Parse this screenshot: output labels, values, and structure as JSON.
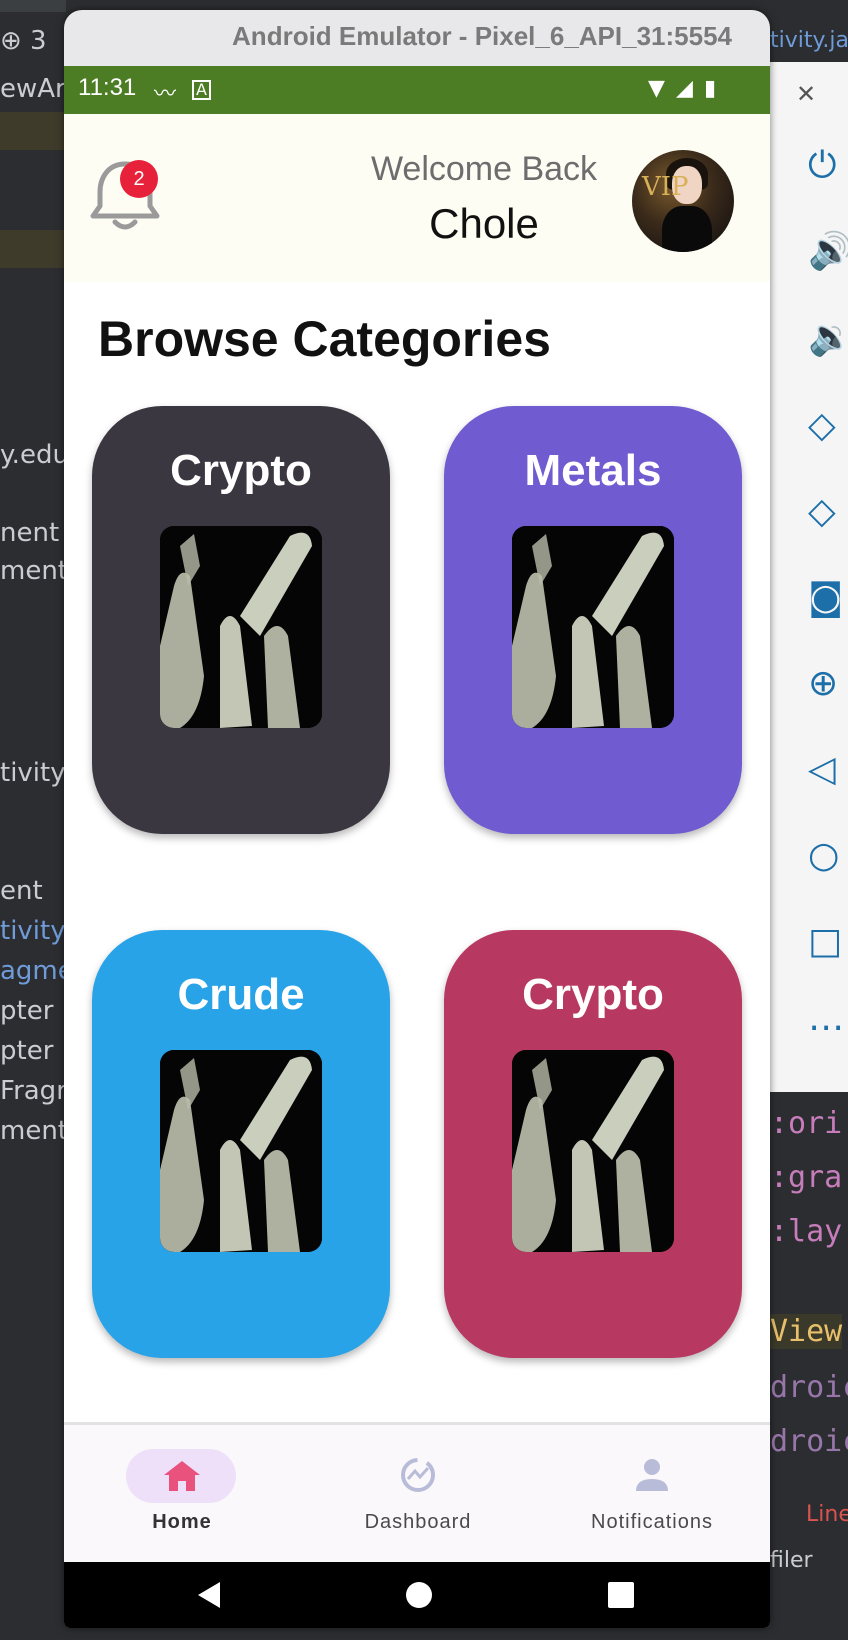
{
  "window": {
    "title": "Android Emulator - Pixel_6_API_31:5554"
  },
  "status_bar": {
    "time": "11:31"
  },
  "header": {
    "notification_count": "2",
    "welcome": "Welcome Back",
    "username": "Chole",
    "avatar_text": "VIP"
  },
  "section": {
    "title": "Browse Categories"
  },
  "categories": [
    {
      "label": "Crypto",
      "color": "#3a3740"
    },
    {
      "label": "Metals",
      "color": "#705bd0"
    },
    {
      "label": "Crude",
      "color": "#28a3e8"
    },
    {
      "label": "Crypto",
      "color": "#b73860"
    }
  ],
  "bottom_nav": {
    "items": [
      {
        "label": "Home",
        "active": true
      },
      {
        "label": "Dashboard",
        "active": false
      },
      {
        "label": "Notifications",
        "active": false
      }
    ],
    "accent": "#e8527c",
    "active_pill": "#eee0f8"
  },
  "ide": {
    "tab_label": "tivity.java",
    "left_fragments": [
      "ewAr",
      "y.edu.",
      "nent",
      "ment",
      "tivity",
      "ent",
      "tivity",
      "agme",
      "pter",
      "pter",
      "Fragm",
      "ment"
    ],
    "right_code": [
      ":ori",
      ":gra",
      ":lay",
      "View",
      "droic",
      "droic"
    ],
    "right_bottom": [
      "Line",
      "filer"
    ]
  }
}
